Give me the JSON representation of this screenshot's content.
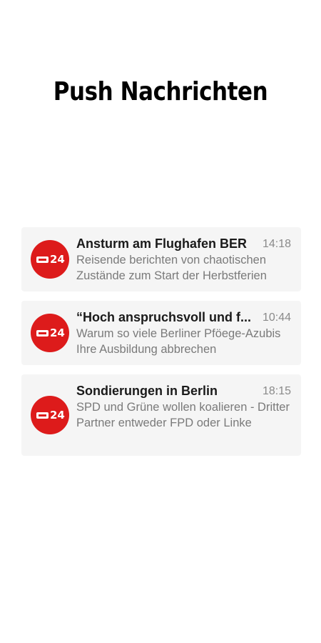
{
  "header": {
    "title": "Push Nachrichten"
  },
  "brand": {
    "accent": "#dd1b1b",
    "badge_text": "24"
  },
  "notifications": [
    {
      "title": "Ansturm am Flughafen BER",
      "time": "14:18",
      "body": "Reisende berichten von chaotischen Zustände zum Start der Herbstferien",
      "icon": "news-24-logo-icon"
    },
    {
      "title": "“Hoch anspruchsvoll und f...",
      "time": "10:44",
      "body": "Warum so viele Berliner Pföege-Azubis Ihre Ausbildung abbrechen",
      "icon": "news-24-logo-icon"
    },
    {
      "title": "Sondierungen in Berlin",
      "time": "18:15",
      "body": "SPD und Grüne wollen koalieren - Dritter Partner entweder FPD oder Linke",
      "icon": "news-24-logo-icon"
    }
  ]
}
